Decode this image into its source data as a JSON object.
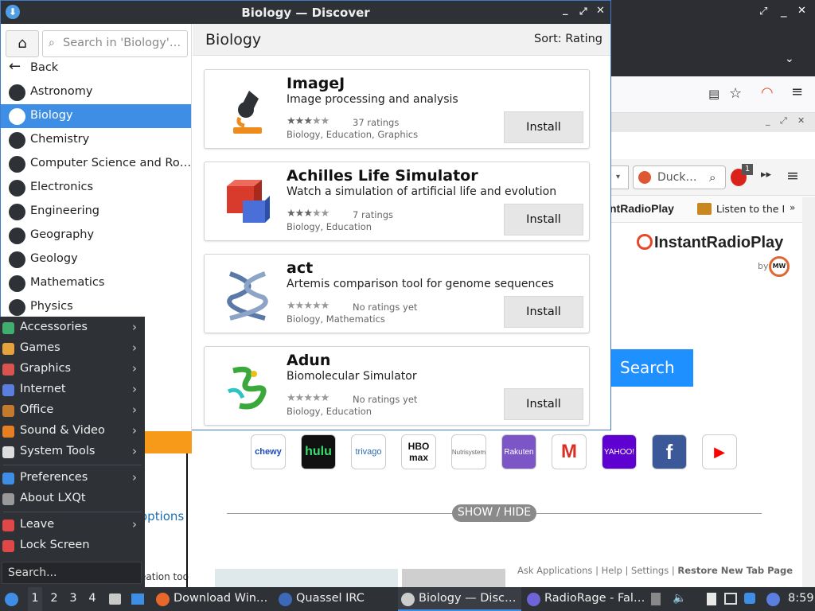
{
  "window": {
    "title": "Biology — Discover"
  },
  "window_controls": [
    "_",
    "⤢",
    "✕"
  ],
  "sidebar": {
    "search_placeholder": "Search in 'Biology'…",
    "items": [
      {
        "label": "Back",
        "icon": "back-arrow-icon"
      },
      {
        "label": "Astronomy",
        "icon": "astronomy-icon"
      },
      {
        "label": "Biology",
        "icon": "biology-icon",
        "selected": true
      },
      {
        "label": "Chemistry",
        "icon": "chemistry-icon"
      },
      {
        "label": "Computer Science and Ro…",
        "icon": "computer-science-icon"
      },
      {
        "label": "Electronics",
        "icon": "electronics-icon"
      },
      {
        "label": "Engineering",
        "icon": "engineering-icon"
      },
      {
        "label": "Geography",
        "icon": "geography-icon"
      },
      {
        "label": "Geology",
        "icon": "geology-icon"
      },
      {
        "label": "Mathematics",
        "icon": "mathematics-icon"
      },
      {
        "label": "Physics",
        "icon": "physics-icon"
      }
    ]
  },
  "main": {
    "title": "Biology",
    "sort": "Sort: Rating",
    "apps": [
      {
        "name": "ImageJ",
        "description": "Image processing and analysis",
        "rating": 3,
        "ratings_text": "37 ratings",
        "tags": "Biology, Education, Graphics",
        "button": "Install",
        "icon": "microscope-icon"
      },
      {
        "name": "Achilles Life Simulator",
        "description": "Watch a simulation of artificial life and evolution",
        "rating": 3,
        "ratings_text": "7 ratings",
        "tags": "Biology, Education",
        "button": "Install",
        "icon": "cubes-icon"
      },
      {
        "name": "act",
        "description": "Artemis comparison tool for genome sequences",
        "rating": 0,
        "ratings_text": "No ratings yet",
        "tags": "Biology, Mathematics",
        "button": "Install",
        "icon": "dna-icon"
      },
      {
        "name": "Adun",
        "description": "Biomolecular Simulator",
        "rating": 0,
        "ratings_text": "No ratings yet",
        "tags": "Biology, Education",
        "button": "Install",
        "icon": "protein-icon"
      }
    ]
  },
  "app_menu": {
    "groups": [
      [
        {
          "label": "Accessories",
          "submenu": true,
          "color": "#3fae6e"
        },
        {
          "label": "Games",
          "submenu": true,
          "color": "#e6a23c"
        },
        {
          "label": "Graphics",
          "submenu": true,
          "color": "#d9534f"
        },
        {
          "label": "Internet",
          "submenu": true,
          "color": "#5b7fe0"
        },
        {
          "label": "Office",
          "submenu": true,
          "color": "#c47a2c"
        },
        {
          "label": "Sound & Video",
          "submenu": true,
          "color": "#e67e22"
        },
        {
          "label": "System Tools",
          "submenu": true,
          "color": "#dddddd"
        }
      ],
      [
        {
          "label": "Preferences",
          "submenu": true,
          "color": "#3d8ee4"
        },
        {
          "label": "About LXQt",
          "submenu": false,
          "color": "#999999"
        }
      ],
      [
        {
          "label": "Leave",
          "submenu": true,
          "color": "#e04848"
        },
        {
          "label": "Lock Screen",
          "submenu": false,
          "color": "#e04848"
        }
      ]
    ],
    "search_placeholder": "Search..."
  },
  "browser": {
    "search_engine_text": "Duck…",
    "badge": "1",
    "bookmark_1": "ntRadioPlay",
    "bookmark_2": "Listen to the I",
    "logo_text": "InstantRadioPlay",
    "logo_by": "by",
    "logo_mw": "MW",
    "search_button": "Search",
    "tiles": [
      "chewy",
      "hulu",
      "trivago",
      "HBO max",
      "Nutrisystem",
      "Rakuten",
      "M",
      "YAHOO!",
      "f",
      "▶"
    ],
    "show_hide": "SHOW / HIDE",
    "options_text": "options",
    "creation_text": "eation too",
    "footer": {
      "ask": "Ask Applications",
      "help": "Help",
      "settings": "Settings",
      "restore": "Restore New Tab Page",
      "sep": "|"
    }
  },
  "taskbar": {
    "workspaces": [
      "1",
      "2",
      "3",
      "4"
    ],
    "tasks": [
      {
        "label": "Download Win…",
        "icon": "firefox-icon"
      },
      {
        "label": "Quassel IRC",
        "icon": "quassel-icon"
      },
      {
        "label": "Biology — Disc…",
        "icon": "discover-icon",
        "active": true
      },
      {
        "label": "RadioRage - Fal…",
        "icon": "radiorage-icon"
      }
    ],
    "clock": "8:59"
  }
}
